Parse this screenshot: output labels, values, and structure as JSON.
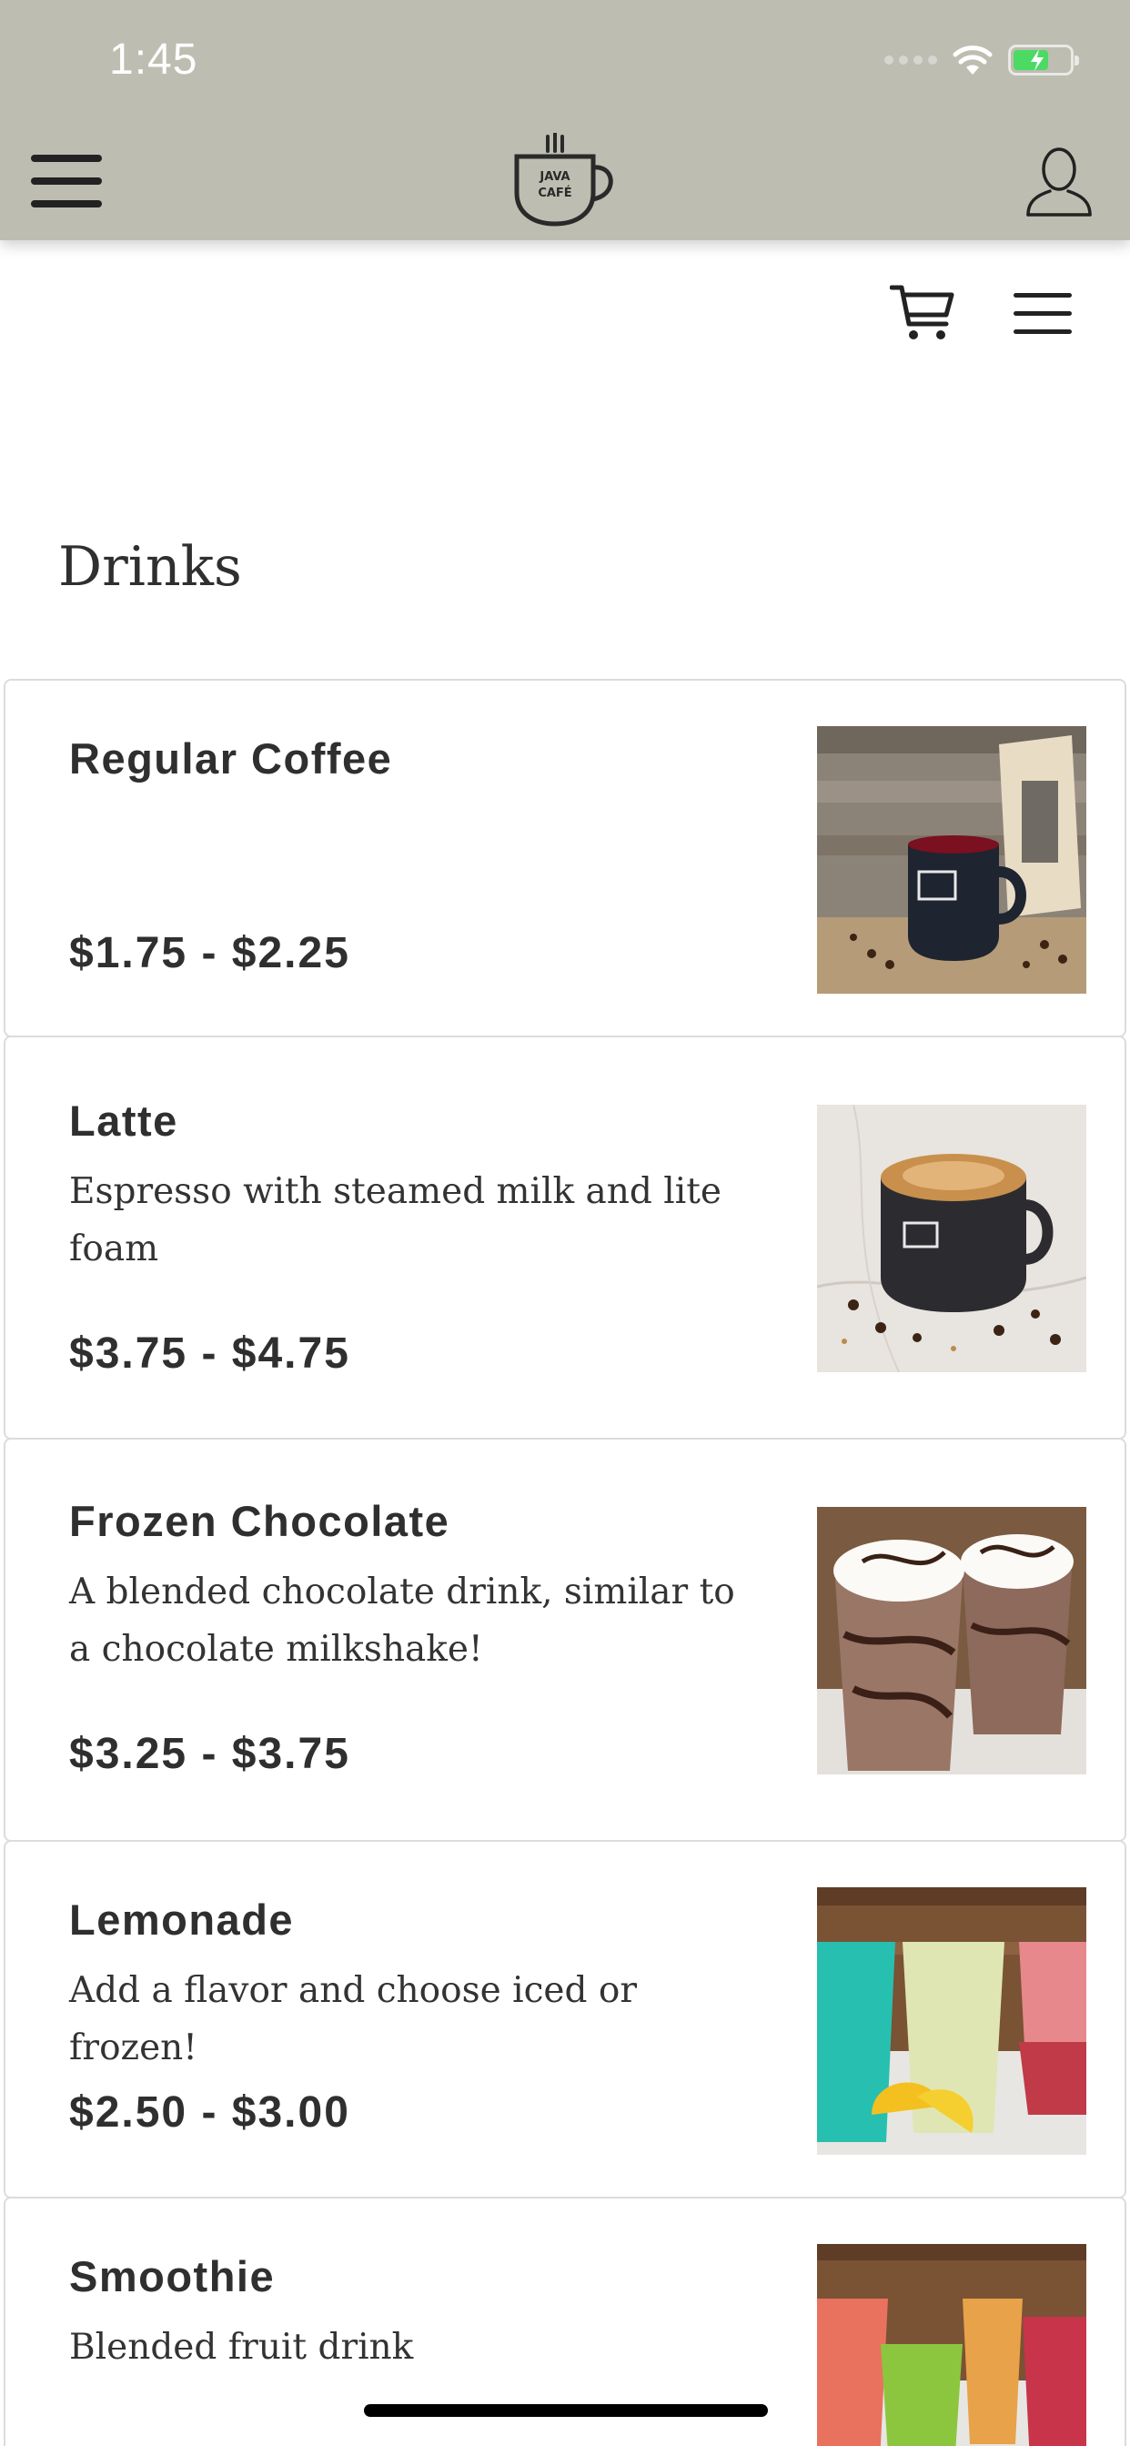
{
  "status_bar": {
    "time": "1:45"
  },
  "header": {
    "menu_icon": "hamburger-icon",
    "logo": {
      "line1": "JAVA",
      "line2": "CAFÉ"
    },
    "profile_icon": "user-icon"
  },
  "toolbar": {
    "cart_icon": "cart-icon",
    "menu_icon": "hamburger-icon"
  },
  "page": {
    "title": "Drinks"
  },
  "items": [
    {
      "name": "Regular Coffee",
      "description": "",
      "price": "$1.75 - $2.25",
      "image": "coffee-mug-photo"
    },
    {
      "name": "Latte",
      "description": "Espresso with steamed milk and lite foam",
      "price": "$3.75 - $4.75",
      "image": "latte-photo"
    },
    {
      "name": "Frozen Chocolate",
      "description": "A blended chocolate drink, similar to a chocolate milkshake!",
      "price": "$3.25 - $3.75",
      "image": "frozen-chocolate-photo"
    },
    {
      "name": "Lemonade",
      "description": "Add a flavor and choose iced or frozen!",
      "price": "$2.50 - $3.00",
      "image": "lemonade-photo"
    },
    {
      "name": "Smoothie",
      "description": "Blended fruit drink",
      "price": "",
      "image": "smoothie-photo"
    }
  ],
  "colors": {
    "header_bg": "#bdbdb1",
    "text": "#2f2f2f",
    "divider": "#dcdcdc",
    "battery": "#4cd964"
  }
}
